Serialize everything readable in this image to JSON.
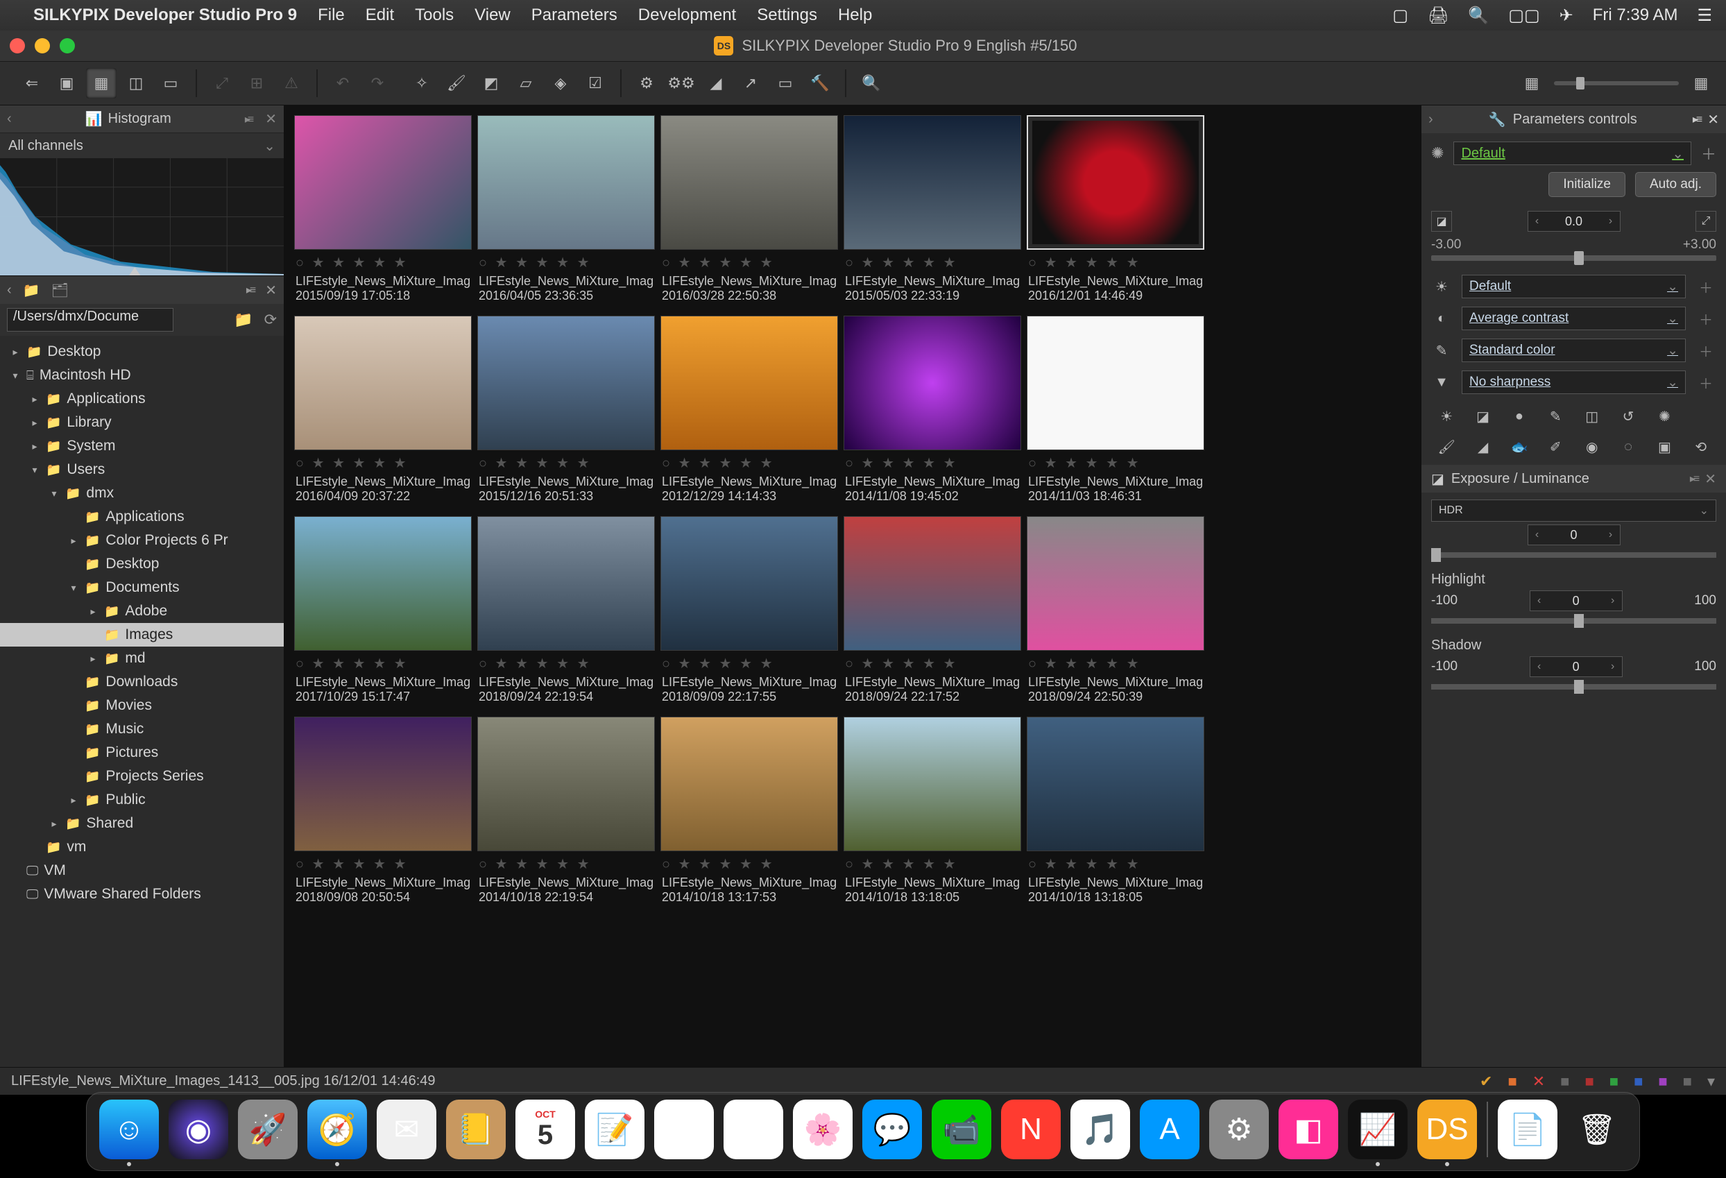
{
  "mac_menu": {
    "app": "SILKYPIX Developer Studio Pro 9",
    "items": [
      "File",
      "Edit",
      "Tools",
      "View",
      "Parameters",
      "Development",
      "Settings",
      "Help"
    ],
    "clock": "Fri 7:39 AM"
  },
  "window_title": "SILKYPIX Developer Studio Pro 9 English   #5/150",
  "histogram": {
    "title": "Histogram",
    "channels": "All channels"
  },
  "browser": {
    "path": "/Users/dmx/Docume"
  },
  "tree": [
    {
      "d": 0,
      "disc": "▸",
      "icon": "📁",
      "label": "Desktop"
    },
    {
      "d": 0,
      "disc": "▾",
      "icon": "hd",
      "label": "Macintosh HD"
    },
    {
      "d": 1,
      "disc": "▸",
      "icon": "📁",
      "label": "Applications"
    },
    {
      "d": 1,
      "disc": "▸",
      "icon": "📁",
      "label": "Library"
    },
    {
      "d": 1,
      "disc": "▸",
      "icon": "📁",
      "label": "System"
    },
    {
      "d": 1,
      "disc": "▾",
      "icon": "📁",
      "label": "Users"
    },
    {
      "d": 2,
      "disc": "▾",
      "icon": "📁",
      "label": "dmx"
    },
    {
      "d": 3,
      "disc": "",
      "icon": "📁",
      "label": "Applications"
    },
    {
      "d": 3,
      "disc": "▸",
      "icon": "📁",
      "label": "Color Projects 6 Pr"
    },
    {
      "d": 3,
      "disc": "",
      "icon": "📁",
      "label": "Desktop"
    },
    {
      "d": 3,
      "disc": "▾",
      "icon": "📁",
      "label": "Documents"
    },
    {
      "d": 4,
      "disc": "▸",
      "icon": "📁",
      "label": "Adobe"
    },
    {
      "d": 4,
      "disc": "",
      "icon": "📁",
      "label": "Images",
      "sel": true
    },
    {
      "d": 4,
      "disc": "▸",
      "icon": "📁",
      "label": "md"
    },
    {
      "d": 3,
      "disc": "",
      "icon": "📁",
      "label": "Downloads"
    },
    {
      "d": 3,
      "disc": "",
      "icon": "📁",
      "label": "Movies"
    },
    {
      "d": 3,
      "disc": "",
      "icon": "📁",
      "label": "Music"
    },
    {
      "d": 3,
      "disc": "",
      "icon": "📁",
      "label": "Pictures"
    },
    {
      "d": 3,
      "disc": "",
      "icon": "📁",
      "label": "Projects Series"
    },
    {
      "d": 3,
      "disc": "▸",
      "icon": "📁",
      "label": "Public"
    },
    {
      "d": 2,
      "disc": "▸",
      "icon": "📁",
      "label": "Shared"
    },
    {
      "d": 1,
      "disc": "",
      "icon": "📁",
      "label": "vm"
    },
    {
      "d": 0,
      "disc": "",
      "icon": "mon",
      "label": "VM"
    },
    {
      "d": 0,
      "disc": "",
      "icon": "mon",
      "label": "VMware Shared Folders"
    }
  ],
  "thumbs": [
    {
      "name": "LIFEstyle_News_MiXture_Image",
      "date": "2015/09/19 17:05:18",
      "bg": "linear-gradient(135deg,#d5a 0%,#356 100%)"
    },
    {
      "name": "LIFEstyle_News_MiXture_Image",
      "date": "2016/04/05 23:36:35",
      "bg": "linear-gradient(#9bb,#678)"
    },
    {
      "name": "LIFEstyle_News_MiXture_Image",
      "date": "2016/03/28 22:50:38",
      "bg": "linear-gradient(#8a8a82,#4a4a44)"
    },
    {
      "name": "LIFEstyle_News_MiXture_Image",
      "date": "2015/05/03 22:33:19",
      "bg": "linear-gradient(#132238,#5a6a78)"
    },
    {
      "name": "LIFEstyle_News_MiXture_Image",
      "date": "2016/12/01 14:46:49",
      "bg": "radial-gradient(circle,#c01020 30%,#111 80%)",
      "sel": true
    },
    {
      "name": "LIFEstyle_News_MiXture_Image",
      "date": "2016/04/09 20:37:22",
      "bg": "linear-gradient(#d8c8b8,#a89078)"
    },
    {
      "name": "LIFEstyle_News_MiXture_Image",
      "date": "2015/12/16 20:51:33",
      "bg": "linear-gradient(#6a8ab0,#304050)"
    },
    {
      "name": "LIFEstyle_News_MiXture_Image",
      "date": "2012/12/29 14:14:33",
      "bg": "linear-gradient(#f0a030,#b06010)"
    },
    {
      "name": "LIFEstyle_News_MiXture_Image",
      "date": "2014/11/08 19:45:02",
      "bg": "radial-gradient(circle,#c040f0,#200040)"
    },
    {
      "name": "LIFEstyle_News_MiXture_Image",
      "date": "2014/11/03 18:46:31",
      "bg": "#f8f8f8"
    },
    {
      "name": "LIFEstyle_News_MiXture_Image",
      "date": "2017/10/29 15:17:47",
      "bg": "linear-gradient(#7ab0d0,#406030)"
    },
    {
      "name": "LIFEstyle_News_MiXture_Image",
      "date": "2018/09/24 22:19:54",
      "bg": "linear-gradient(#8090a0,#304050)"
    },
    {
      "name": "LIFEstyle_News_MiXture_Image",
      "date": "2018/09/09 22:17:55",
      "bg": "linear-gradient(#507090,#203040)"
    },
    {
      "name": "LIFEstyle_News_MiXture_Image",
      "date": "2018/09/24 22:17:52",
      "bg": "linear-gradient(#c04040,#406080)"
    },
    {
      "name": "LIFEstyle_News_MiXture_Image",
      "date": "2018/09/24 22:50:39",
      "bg": "linear-gradient(#888,#e050a0)"
    },
    {
      "name": "LIFEstyle_News_MiXture_Image",
      "date": "2018/09/08 20:50:54",
      "bg": "linear-gradient(#402060,#806040)"
    },
    {
      "name": "LIFEstyle_News_MiXture_Image",
      "date": "2014/10/18 22:19:54",
      "bg": "linear-gradient(#888878,#484838)"
    },
    {
      "name": "LIFEstyle_News_MiXture_Image",
      "date": "2014/10/18 13:17:53",
      "bg": "linear-gradient(#d0a060,#806030)"
    },
    {
      "name": "LIFEstyle_News_MiXture_Image",
      "date": "2014/10/18 13:18:05",
      "bg": "linear-gradient(#b0d0e0,#506030)"
    },
    {
      "name": "LIFEstyle_News_MiXture_Image",
      "date": "2014/10/18 13:18:05",
      "bg": "linear-gradient(#406080,#203040)"
    }
  ],
  "params": {
    "title": "Parameters controls",
    "preset": "Default",
    "btn_init": "Initialize",
    "btn_auto": "Auto adj.",
    "exp_value": "0.0",
    "exp_min": "-3.00",
    "exp_max": "+3.00",
    "wb": "Default",
    "contrast": "Average contrast",
    "color": "Standard color",
    "sharp": "No sharpness"
  },
  "exposure_panel": {
    "title": "Exposure / Luminance",
    "hdr_label": "HDR",
    "hdr_value": "0",
    "highlight_label": "Highlight",
    "highlight_min": "-100",
    "highlight_val": "0",
    "highlight_max": "100",
    "shadow_label": "Shadow",
    "shadow_min": "-100",
    "shadow_val": "0",
    "shadow_max": "100"
  },
  "status": {
    "text": "LIFEstyle_News_MiXture_Images_1413__005.jpg 16/12/01 14:46:49"
  },
  "dock": [
    {
      "name": "finder",
      "bg": "linear-gradient(#29c3fb,#0a5cd6)",
      "glyph": "☺",
      "dot": true
    },
    {
      "name": "siri",
      "bg": "radial-gradient(circle,#6a4cf0,#111)",
      "glyph": "◉"
    },
    {
      "name": "launchpad",
      "bg": "#8a8a8a",
      "glyph": "🚀"
    },
    {
      "name": "safari",
      "bg": "linear-gradient(#4ac0ff,#0060d0)",
      "glyph": "🧭",
      "dot": true
    },
    {
      "name": "mail",
      "bg": "#f0f0f0",
      "glyph": "✉"
    },
    {
      "name": "contacts",
      "bg": "#c89860",
      "glyph": "📒"
    },
    {
      "name": "calendar",
      "bg": "#fff",
      "glyph": "5"
    },
    {
      "name": "notes",
      "bg": "#fff",
      "glyph": "📝"
    },
    {
      "name": "reminders",
      "bg": "#fff",
      "glyph": "☑"
    },
    {
      "name": "maps",
      "bg": "#fff",
      "glyph": "🗺"
    },
    {
      "name": "photos",
      "bg": "#fff",
      "glyph": "🌸"
    },
    {
      "name": "messages",
      "bg": "#09f",
      "glyph": "💬"
    },
    {
      "name": "facetime",
      "bg": "#0c0",
      "glyph": "📹"
    },
    {
      "name": "news",
      "bg": "#ff3b30",
      "glyph": "N"
    },
    {
      "name": "itunes",
      "bg": "#fff",
      "glyph": "🎵"
    },
    {
      "name": "appstore",
      "bg": "#09f",
      "glyph": "A"
    },
    {
      "name": "preferences",
      "bg": "#888",
      "glyph": "⚙"
    },
    {
      "name": "cleanmymac",
      "bg": "#ff2d95",
      "glyph": "◧"
    },
    {
      "name": "activity",
      "bg": "#111",
      "glyph": "📈",
      "dot": true
    },
    {
      "name": "silkypix",
      "bg": "#f5a623",
      "glyph": "DS",
      "dot": true
    },
    {
      "name": "sep"
    },
    {
      "name": "downloads",
      "bg": "#fff",
      "glyph": "📄"
    },
    {
      "name": "trash",
      "bg": "transparent",
      "glyph": "🗑"
    }
  ]
}
